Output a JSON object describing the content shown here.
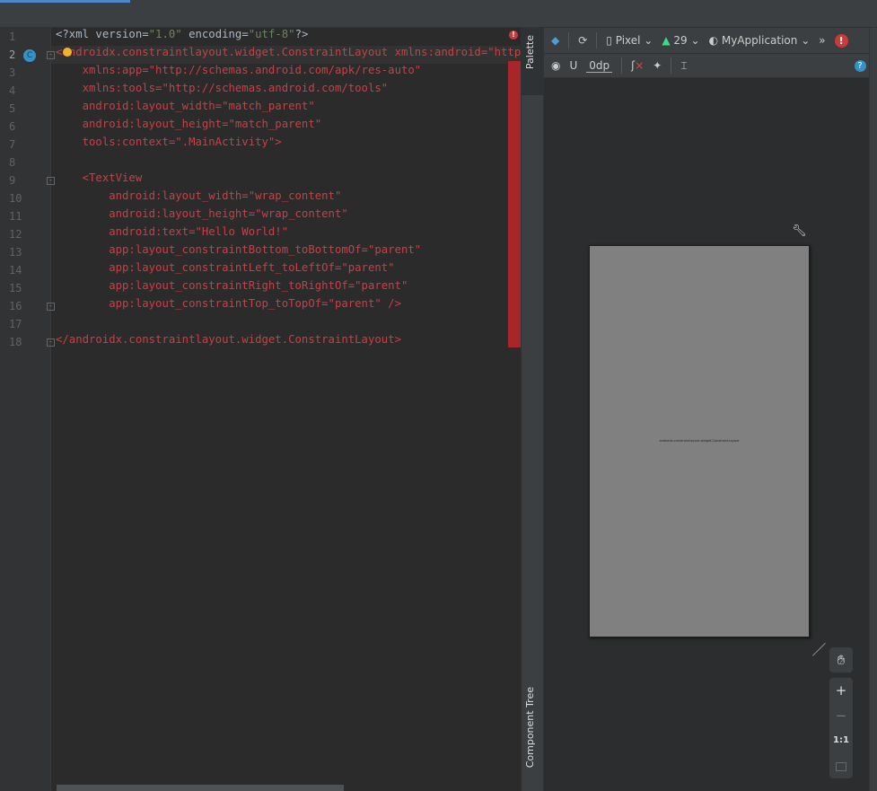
{
  "editor": {
    "lines": [
      {
        "n": "1",
        "parts": [
          [
            "n",
            "<?xml version="
          ],
          [
            "s",
            "\"1.0\""
          ],
          [
            "n",
            " encoding="
          ],
          [
            "s",
            "\"utf-8\""
          ],
          [
            "n",
            "?>"
          ]
        ]
      },
      {
        "n": "2",
        "parts": [
          [
            "r",
            "<androidx.constraintlayout.widget.ConstraintLayout xmlns:android=\"http://schemas.android.com/apk/res/android\""
          ]
        ]
      },
      {
        "n": "3",
        "parts": [
          [
            "r",
            "    xmlns:app=\"http://schemas.android.com/apk/res-auto\""
          ]
        ]
      },
      {
        "n": "4",
        "parts": [
          [
            "r",
            "    xmlns:tools=\"http://schemas.android.com/tools\""
          ]
        ]
      },
      {
        "n": "5",
        "parts": [
          [
            "r",
            "    android:layout_width=\"match_parent\""
          ]
        ]
      },
      {
        "n": "6",
        "parts": [
          [
            "r",
            "    android:layout_height=\"match_parent\""
          ]
        ]
      },
      {
        "n": "7",
        "parts": [
          [
            "r",
            "    tools:context=\".MainActivity\">"
          ]
        ]
      },
      {
        "n": "8",
        "parts": []
      },
      {
        "n": "9",
        "parts": [
          [
            "r",
            "    <TextView"
          ]
        ]
      },
      {
        "n": "10",
        "parts": [
          [
            "r",
            "        android:layout_width=\"wrap_content\""
          ]
        ]
      },
      {
        "n": "11",
        "parts": [
          [
            "r",
            "        android:layout_height=\"wrap_content\""
          ]
        ]
      },
      {
        "n": "12",
        "parts": [
          [
            "r",
            "        android:text=\"Hello World!\""
          ]
        ]
      },
      {
        "n": "13",
        "parts": [
          [
            "r",
            "        app:layout_constraintBottom_toBottomOf=\"parent\""
          ]
        ]
      },
      {
        "n": "14",
        "parts": [
          [
            "r",
            "        app:layout_constraintLeft_toLeftOf=\"parent\""
          ]
        ]
      },
      {
        "n": "15",
        "parts": [
          [
            "r",
            "        app:layout_constraintRight_toRightOf=\"parent\""
          ]
        ]
      },
      {
        "n": "16",
        "parts": [
          [
            "r",
            "        app:layout_constraintTop_toTopOf=\"parent\" />"
          ]
        ]
      },
      {
        "n": "17",
        "parts": []
      },
      {
        "n": "18",
        "parts": [
          [
            "r",
            "</androidx.constraintlayout.widget.ConstraintLayout>"
          ]
        ]
      }
    ],
    "gutter_badge": "C",
    "error_mark": "!"
  },
  "side_tabs": {
    "palette": "Palette",
    "component_tree": "Component Tree"
  },
  "toolbar": {
    "device": "Pixel",
    "api": "29",
    "theme": "MyApplication",
    "margin": "0dp",
    "more": "»",
    "help": "?",
    "error": "!"
  },
  "preview": {
    "text": "androidx.constraintlayout.widget.ConstraintLayout"
  },
  "zoom": {
    "zoom_in": "+",
    "zoom_out": "−",
    "actual_size": "1:1"
  },
  "colors": {
    "accent": "#4a88c7",
    "error": "#c93b3b",
    "android_green": "#3ddc84",
    "canvas": "#808080"
  }
}
